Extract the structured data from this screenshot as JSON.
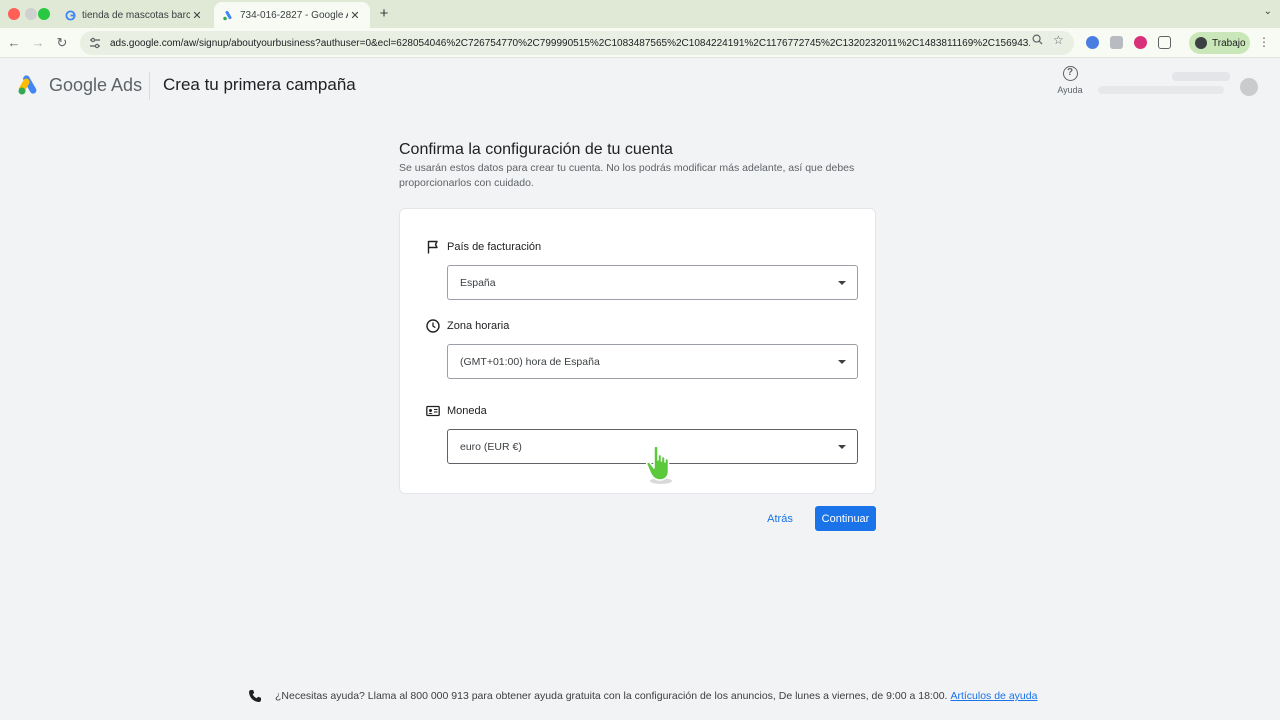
{
  "browser": {
    "tabs": [
      {
        "title": "tienda de mascotas barcelona",
        "active": false
      },
      {
        "title": "734-016-2827 - Google Ads",
        "active": true
      }
    ],
    "url": "ads.google.com/aw/signup/aboutyourbusiness?authuser=0&ecl=628054046%2C726754770%2C799990515%2C1083487565%2C1084224191%2C1176772745%2C1320232011%2C1483811169%2C156943...",
    "profile_label": "Trabajo"
  },
  "header": {
    "brand": "Google Ads",
    "title": "Crea tu primera campaña",
    "help_label": "Ayuda"
  },
  "main": {
    "heading": "Confirma la configuración de tu cuenta",
    "subtitle": "Se usarán estos datos para crear tu cuenta. No los podrás modificar más adelante, así que debes proporcionarlos con cuidado.",
    "fields": {
      "country": {
        "label": "País de facturación",
        "value": "España"
      },
      "timezone": {
        "label": "Zona horaria",
        "value": "(GMT+01:00) hora de España"
      },
      "currency": {
        "label": "Moneda",
        "value": "euro (EUR €)"
      }
    },
    "back_label": "Atrás",
    "continue_label": "Continuar"
  },
  "footer": {
    "text": "¿Necesitas ayuda? Llama al 800 000 913 para obtener ayuda gratuita con la configuración de los anuncios, De lunes a viernes, de 9:00 a 18:00.",
    "link": "Artículos de ayuda"
  },
  "colors": {
    "accent": "#1a73e8",
    "tabbar": "#dfe9d6",
    "cursor": "#5cc93a"
  }
}
